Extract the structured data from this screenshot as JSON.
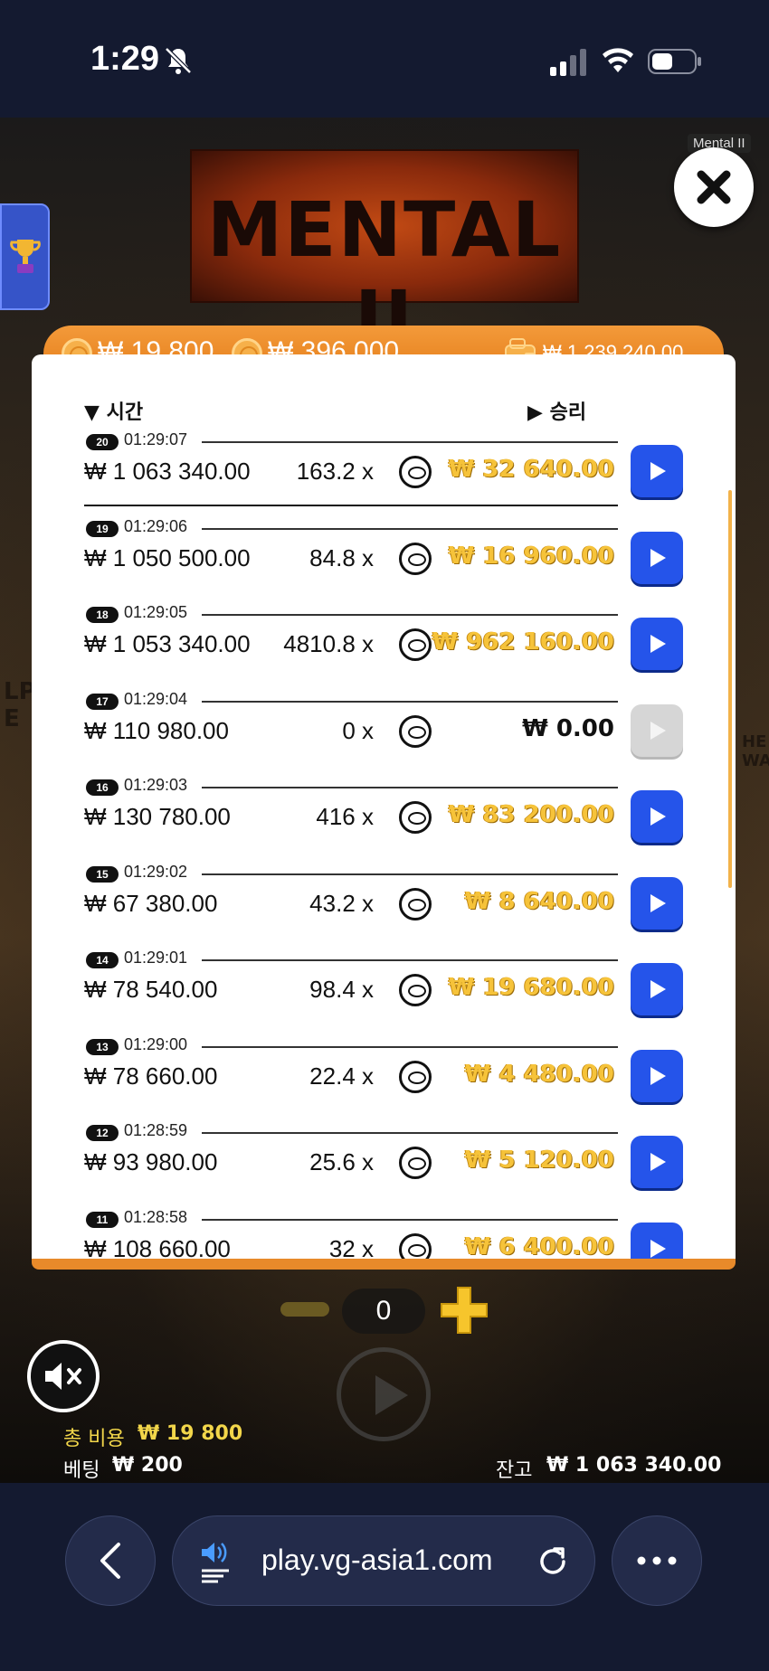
{
  "status_bar": {
    "time": "1:29"
  },
  "game": {
    "label": "Mental II",
    "logo_text": "MENTAL II",
    "wall_sign_left": "LP\nE",
    "wall_sign_right": "HE\nWAT"
  },
  "balance_bar": {
    "bet_cost": "₩ 19 800",
    "max_win": "₩ 396 000",
    "wallet": "₩ 1 239 240.00"
  },
  "history": {
    "col_time": "시간",
    "col_win": "승리",
    "rows": [
      {
        "index": "20",
        "time": "01:29:07",
        "bet": "₩ 1 063 340.00",
        "mult": "163.2 x",
        "win": "₩ 32 640.00"
      },
      {
        "index": "19",
        "time": "01:29:06",
        "bet": "₩ 1 050 500.00",
        "mult": "84.8 x",
        "win": "₩ 16 960.00"
      },
      {
        "index": "18",
        "time": "01:29:05",
        "bet": "₩ 1 053 340.00",
        "mult": "4810.8 x",
        "win": "₩ 962 160.00"
      },
      {
        "index": "17",
        "time": "01:29:04",
        "bet": "₩ 110 980.00",
        "mult": "0 x",
        "win": "₩ 0.00"
      },
      {
        "index": "16",
        "time": "01:29:03",
        "bet": "₩ 130 780.00",
        "mult": "416 x",
        "win": "₩ 83 200.00"
      },
      {
        "index": "15",
        "time": "01:29:02",
        "bet": "₩ 67 380.00",
        "mult": "43.2 x",
        "win": "₩ 8 640.00"
      },
      {
        "index": "14",
        "time": "01:29:01",
        "bet": "₩ 78 540.00",
        "mult": "98.4 x",
        "win": "₩ 19 680.00"
      },
      {
        "index": "13",
        "time": "01:29:00",
        "bet": "₩ 78 660.00",
        "mult": "22.4 x",
        "win": "₩ 4 480.00"
      },
      {
        "index": "12",
        "time": "01:28:59",
        "bet": "₩ 93 980.00",
        "mult": "25.6 x",
        "win": "₩ 5 120.00"
      },
      {
        "index": "11",
        "time": "01:28:58",
        "bet": "₩ 108 660.00",
        "mult": "32 x",
        "win": "₩ 6 400.00"
      }
    ]
  },
  "controls": {
    "bet_count": "0",
    "total_cost_label": "총 비용",
    "total_cost_value": "₩ 19 800",
    "bet_label": "베팅",
    "bet_value": "₩ 200",
    "balance_label": "잔고",
    "balance_value": "₩ 1 063 340.00"
  },
  "browser": {
    "url": "play.vg-asia1.com"
  },
  "colors": {
    "accent_orange": "#e8892a",
    "play_blue": "#2554ea",
    "win_gold": "#f6c33a"
  }
}
